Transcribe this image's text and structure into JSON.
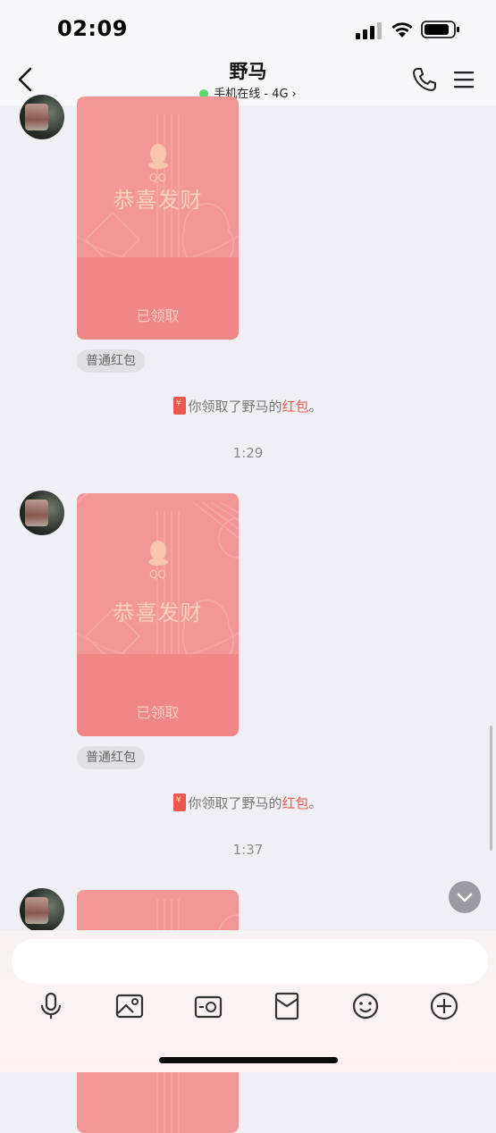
{
  "status_bar": {
    "time": "02:09"
  },
  "header": {
    "title": "野马",
    "status_text": "手机在线 - 4G",
    "online_color": "#5fd76a"
  },
  "messages": [
    {
      "qq": "QQ",
      "greeting": "恭喜发财",
      "status": "已领取",
      "tag": "普通红包"
    },
    {
      "qq": "QQ",
      "greeting": "恭喜发财",
      "status": "已领取",
      "tag": "普通红包"
    }
  ],
  "system_msgs": [
    {
      "prefix": "你领取了野马的",
      "link": "红包",
      "suffix": "。"
    },
    {
      "prefix": "你领取了野马的",
      "link": "红包",
      "suffix": "。"
    }
  ],
  "timestamps": [
    "1:29",
    "1:37"
  ],
  "input": {
    "placeholder": ""
  },
  "toolbar_icons": [
    "microphone-icon",
    "image-icon",
    "camera-icon",
    "red-packet-icon",
    "emoji-icon",
    "plus-icon"
  ],
  "colors": {
    "red_packet": "#f29796",
    "link_red": "#e55c4e"
  }
}
